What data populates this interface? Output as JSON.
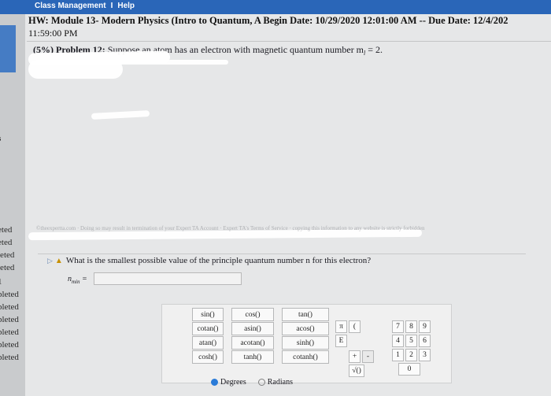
{
  "topbar": {
    "link1": "Class Management",
    "separator": "I",
    "link2": "Help"
  },
  "header": {
    "title": "HW: Module 13- Modern Physics (Intro to Quantum, A",
    "begin": "Begin Date: 10/29/2020 12:01:00 AM",
    "due": "-- Due Date: 12/4/202",
    "time": "11:59:00 PM"
  },
  "problem": {
    "weight": "(5%)",
    "label": "Problem 12:",
    "text": "Suppose an atom has an electron with magnetic quantum number m",
    "subscript": "l",
    "text_end": "= 2."
  },
  "fineprint": "©theexpertta.com · Doing so may result in termination of your Expert TA Account · Expert TA's Terms of Service · copying this information to any website is strictly forbidden",
  "question": {
    "text": "What is the smallest possible value of the principle quantum number n for this electron?",
    "answer_label": "n",
    "answer_sub": "min",
    "answer_eq": "=",
    "answer_value": ""
  },
  "leftstrip": {
    "items": [
      "s",
      "eted",
      "eted",
      "leted",
      "leted",
      "1",
      "pleted",
      "pleted",
      "pleted",
      "pleted",
      "pleted",
      "pleted"
    ]
  },
  "calculator": {
    "functions": [
      [
        "sin()",
        "cos()",
        "tan()"
      ],
      [
        "cotan()",
        "asin()",
        "acos()"
      ],
      [
        "atan()",
        "acotan()",
        "sinh()"
      ],
      [
        "cosh()",
        "tanh()",
        "cotanh()"
      ]
    ],
    "pi": "π",
    "paren": "(",
    "e": "E",
    "plus": "+",
    "minus": "-",
    "sqrt": "√()",
    "digits_row1": [
      "7",
      "8",
      "9"
    ],
    "digits_row2": [
      "4",
      "5",
      "6"
    ],
    "digits_row3": [
      "1",
      "2",
      "3"
    ],
    "zero": "0",
    "degrees": "Degrees",
    "radians": "Radians"
  }
}
